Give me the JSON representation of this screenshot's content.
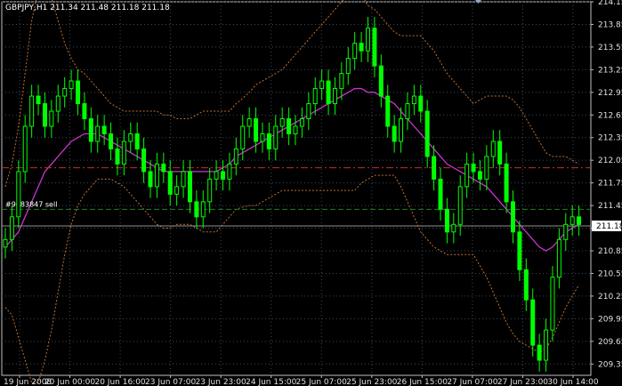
{
  "header": {
    "title": "GBPJPY,H1  211.34 211.48 211.18 211.18"
  },
  "colors": {
    "background": "#000000",
    "grid": "#3a4a5a",
    "candle": "#00ff00",
    "ma": "#cc33cc",
    "bands": "#c07030",
    "take_profit": "#c03030",
    "open_price": "#208020",
    "bid": "#909090"
  },
  "chart_data": {
    "type": "candlestick",
    "symbol": "GBPJPY",
    "timeframe": "H1",
    "ohlc_header": {
      "open": 211.34,
      "high": 211.48,
      "low": 211.18,
      "close": 211.18
    },
    "ylim": [
      209.2,
      214.15
    ],
    "y_ticks": [
      "214.15",
      "213.85",
      "213.55",
      "213.25",
      "212.95",
      "212.65",
      "212.35",
      "212.05",
      "211.75",
      "211.45",
      "211.15",
      "210.85",
      "210.55",
      "210.25",
      "209.95",
      "209.65",
      "209.35"
    ],
    "x_ticks": [
      "19 Jun 2008",
      "20 Jun 00:00",
      "20 Jun 16:00",
      "23 Jun 07:00",
      "23 Jun 23:00",
      "24 Jun 15:00",
      "25 Jun 07:00",
      "25 Jun 23:00",
      "26 Jun 15:00",
      "27 Jun 07:00",
      "27 Jun 23:00",
      "30 Jun 14:00"
    ],
    "current_price": "211.18",
    "grid": true,
    "order": {
      "label": "#9683847 sell",
      "price": 211.18
    },
    "levels": {
      "take_profit": 211.95,
      "open_price": 211.4,
      "bid": 211.18
    },
    "closes": [
      211.0,
      211.3,
      211.9,
      212.5,
      212.9,
      212.8,
      212.5,
      212.7,
      212.9,
      213.0,
      213.1,
      212.8,
      212.6,
      212.3,
      212.5,
      212.4,
      212.2,
      212.0,
      212.3,
      212.4,
      212.2,
      211.9,
      211.7,
      212.0,
      211.9,
      211.6,
      211.7,
      211.9,
      211.5,
      211.3,
      211.5,
      211.8,
      211.9,
      211.8,
      212.0,
      212.2,
      212.5,
      212.6,
      212.3,
      212.4,
      212.2,
      212.5,
      212.6,
      212.4,
      212.5,
      212.6,
      212.8,
      213.0,
      213.1,
      212.8,
      213.0,
      213.2,
      213.4,
      213.6,
      213.5,
      213.8,
      213.3,
      212.9,
      212.5,
      212.3,
      212.6,
      212.8,
      212.9,
      212.7,
      212.1,
      211.8,
      211.4,
      211.1,
      211.2,
      211.7,
      212.0,
      211.9,
      211.8,
      212.1,
      212.3,
      212.0,
      211.5,
      211.1,
      210.6,
      210.2,
      209.6,
      209.4,
      209.8,
      210.5,
      211.0,
      211.2,
      211.3,
      211.2
    ],
    "ma_values": [
      210.9,
      211.0,
      211.1,
      211.3,
      211.5,
      211.7,
      211.9,
      212.0,
      212.1,
      212.2,
      212.3,
      212.35,
      212.4,
      212.4,
      212.4,
      212.35,
      212.3,
      212.25,
      212.2,
      212.15,
      212.1,
      212.05,
      212.0,
      211.95,
      211.9,
      211.9,
      211.9,
      211.9,
      211.9,
      211.9,
      211.9,
      211.9,
      211.9,
      211.95,
      212.0,
      212.1,
      212.15,
      212.2,
      212.25,
      212.3,
      212.35,
      212.4,
      212.45,
      212.5,
      212.55,
      212.6,
      212.65,
      212.7,
      212.75,
      212.8,
      212.85,
      212.9,
      212.95,
      213.0,
      213.0,
      212.95,
      212.95,
      212.9,
      212.85,
      212.8,
      212.7,
      212.6,
      212.5,
      212.4,
      212.3,
      212.2,
      212.1,
      212.0,
      211.95,
      211.9,
      211.85,
      211.8,
      211.75,
      211.7,
      211.6,
      211.5,
      211.4,
      211.3,
      211.2,
      211.1,
      211.0,
      210.9,
      210.85,
      210.9,
      211.0,
      211.1,
      211.15,
      211.2
    ],
    "band_width": [
      0.8,
      1.0,
      1.4,
      1.9,
      2.4,
      2.6,
      2.5,
      2.2,
      1.8,
      1.4,
      1.1,
      0.9,
      0.8,
      0.7,
      0.6,
      0.55,
      0.5,
      0.5,
      0.5,
      0.55,
      0.6,
      0.65,
      0.7,
      0.75,
      0.75,
      0.75,
      0.7,
      0.7,
      0.7,
      0.75,
      0.8,
      0.8,
      0.8,
      0.75,
      0.7,
      0.7,
      0.72,
      0.75,
      0.8,
      0.8,
      0.8,
      0.8,
      0.8,
      0.85,
      0.9,
      0.95,
      1.0,
      1.05,
      1.1,
      1.15,
      1.2,
      1.25,
      1.3,
      1.35,
      1.25,
      1.15,
      1.1,
      1.05,
      1.0,
      0.95,
      1.0,
      1.1,
      1.2,
      1.3,
      1.3,
      1.3,
      1.25,
      1.2,
      1.15,
      1.1,
      1.05,
      1.0,
      1.1,
      1.2,
      1.3,
      1.4,
      1.5,
      1.55,
      1.55,
      1.5,
      1.45,
      1.4,
      1.3,
      1.2,
      1.1,
      1.0,
      0.9,
      0.8
    ]
  }
}
